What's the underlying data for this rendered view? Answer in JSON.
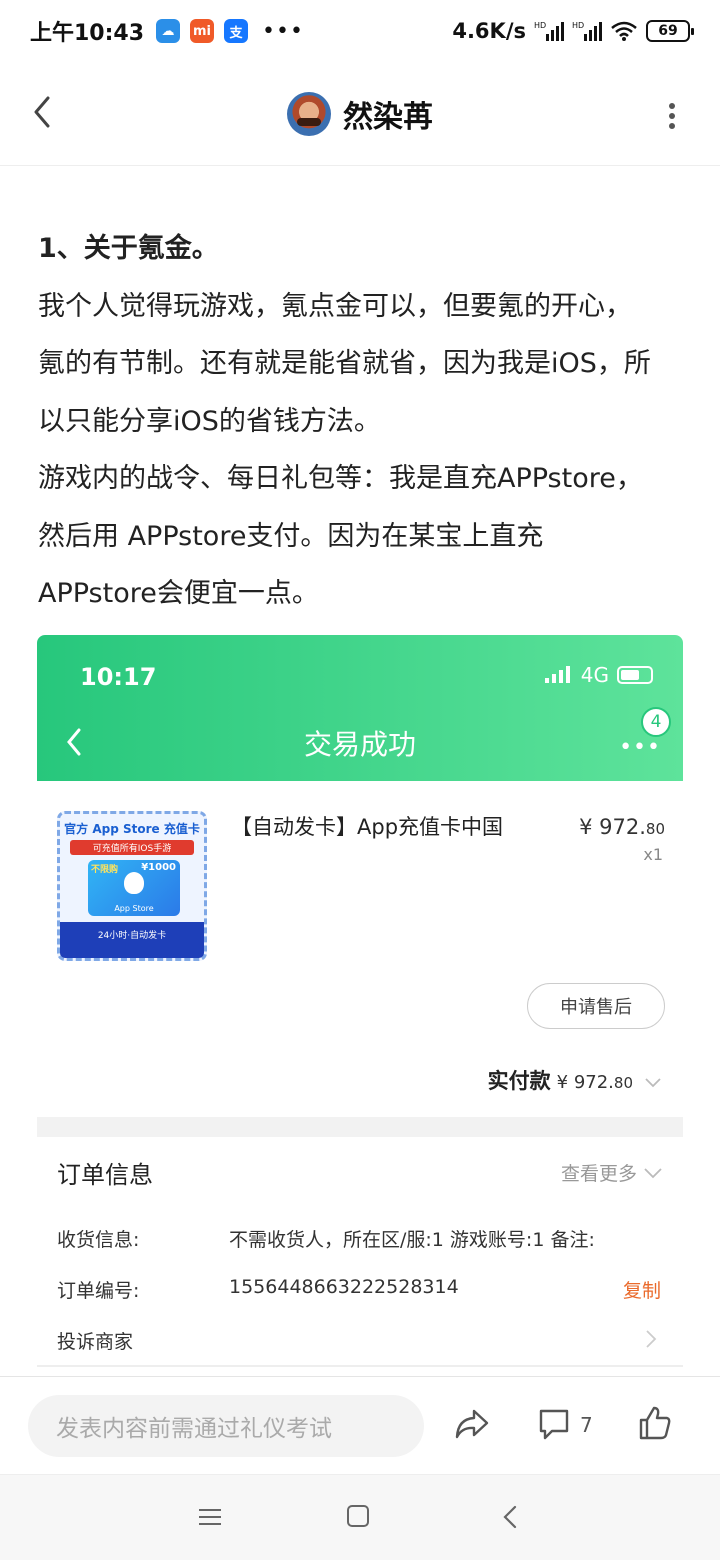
{
  "status_bar": {
    "time": "上午10:43",
    "app_icons": [
      {
        "name": "cloud-app-icon",
        "glyph": "☁",
        "color": "#2b8fe8"
      },
      {
        "name": "mi-app-icon",
        "glyph": "mi",
        "color": "#f05a28"
      },
      {
        "name": "alipay-app-icon",
        "glyph": "支",
        "color": "#1677ff"
      }
    ],
    "more": "•••",
    "net_speed": "4.6K/s",
    "battery": "69"
  },
  "header": {
    "author_name": "然染苒"
  },
  "article": {
    "heading": "1、关于氪金。",
    "lines": [
      "我个人觉得玩游戏，氪点金可以，但要氪的开心，",
      "氪的有节制。还有就是能省就省，因为我是iOS，所",
      "以只能分享iOS的省钱方法。",
      "游戏内的战令、每日礼包等：我是直充APPstore，",
      "然后用 APPstore支付。因为在某宝上直充",
      "APPstore会便宜一点。"
    ]
  },
  "embedded": {
    "time": "10:17",
    "network": "4G",
    "title": "交易成功",
    "badge": "4",
    "product_image": {
      "line1": "官方 App Store 充值卡",
      "line2": "可充值所有IOS手游",
      "unlimited": "不限购",
      "amount": "¥1000",
      "caption": "App Store",
      "bottom": "24小时·自动发卡"
    },
    "product_name": "【自动发卡】App充值卡中国",
    "price_main": "¥ 972.",
    "price_decimal": "80",
    "quantity": "x1",
    "after_sale": "申请售后",
    "paid_label": "实付款",
    "paid_main": "¥ 972.",
    "paid_decimal": "80",
    "order_title": "订单信息",
    "view_more": "查看更多",
    "rows": [
      {
        "key": "收货信息:",
        "value": "不需收货人，所在区/服:1 游戏账号:1 备注:"
      },
      {
        "key": "订单编号:",
        "value": "1556448663222528314",
        "action": "复制"
      },
      {
        "key": "投诉商家",
        "value": ""
      }
    ]
  },
  "action_bar": {
    "comment_placeholder": "发表内容前需通过礼仪考试",
    "comment_count": "7"
  },
  "colors": {
    "accent_green": "#27c77c",
    "copy_orange": "#ea6a2b"
  }
}
